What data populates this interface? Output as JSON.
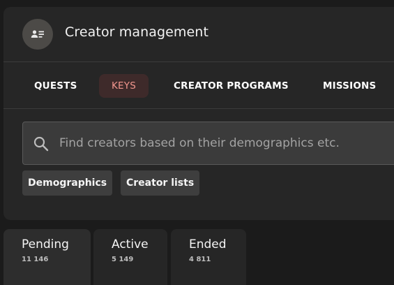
{
  "header": {
    "title": "Creator management",
    "avatar_icon": "contact-card-icon"
  },
  "tabs": [
    {
      "label": "QUESTS",
      "active": false
    },
    {
      "label": "KEYS",
      "active": true
    },
    {
      "label": "CREATOR PROGRAMS",
      "active": false
    },
    {
      "label": "MISSIONS",
      "active": false
    }
  ],
  "search": {
    "placeholder": "Find creators based on their demographics etc.",
    "icon": "search-icon"
  },
  "filters": [
    {
      "label": "Demographics"
    },
    {
      "label": "Creator lists"
    }
  ],
  "status_tabs": [
    {
      "label": "Pending",
      "count": "11 146",
      "selected": true
    },
    {
      "label": "Active",
      "count": "5 149",
      "selected": false
    },
    {
      "label": "Ended",
      "count": "4 811",
      "selected": false
    }
  ],
  "colors": {
    "background": "#1b1b1b",
    "card": "#262626",
    "active_tab_bg": "#3e2a2a",
    "active_tab_text": "#f2968e"
  }
}
